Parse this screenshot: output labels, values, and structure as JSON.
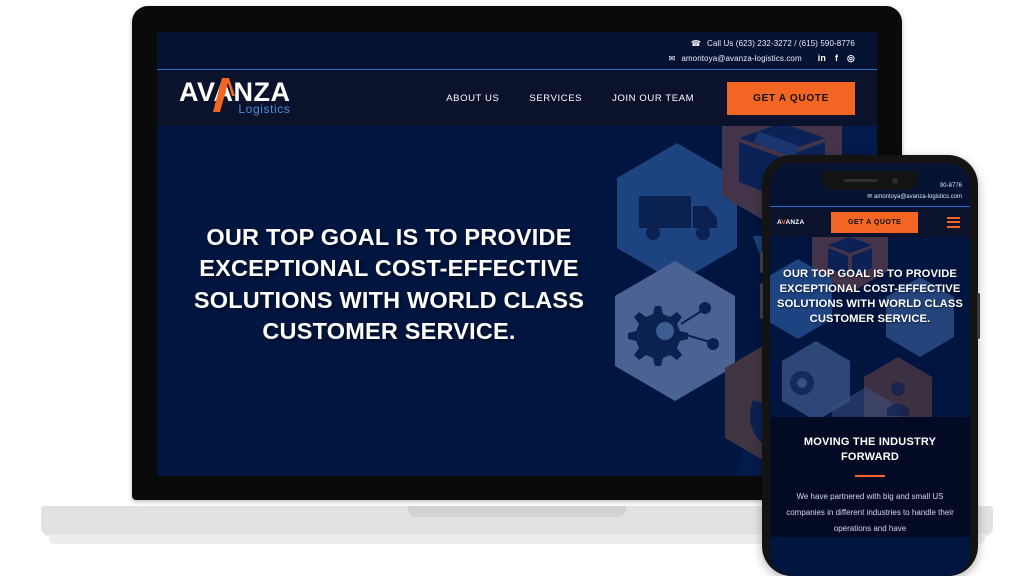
{
  "device_mockup": {
    "devices": [
      "laptop",
      "phone"
    ],
    "background_color": "#ffffff"
  },
  "colors": {
    "navy": "#001540",
    "header_navy": "#0b122c",
    "topbar_navy": "#051232",
    "accent_orange": "#f26522",
    "logo_blue": "#4a8fe0",
    "rule_blue": "#2a6bd4",
    "section_dark": "#030b24"
  },
  "site": {
    "topbar": {
      "phone_icon": "phone-icon",
      "phone_text": "Call Us (623) 232-3272 / (615) 590-8776",
      "mail_icon": "envelope-icon",
      "email": "amontoya@avanza-logistics.com",
      "socials": [
        {
          "name": "linkedin-icon",
          "glyph": "in"
        },
        {
          "name": "facebook-icon",
          "glyph": "f"
        },
        {
          "name": "instagram-icon",
          "glyph": "◎"
        }
      ]
    },
    "brand": {
      "name": "AVANZA",
      "tagline": "Logistics"
    },
    "nav": {
      "links": [
        {
          "label": "ABOUT US"
        },
        {
          "label": "SERVICES"
        },
        {
          "label": "JOIN OUR TEAM"
        }
      ],
      "cta_label": "GET A QUOTE"
    },
    "hero": {
      "headline": "OUR TOP GOAL IS TO PROVIDE EXCEPTIONAL COST-EFFECTIVE SOLUTIONS WITH WORLD CLASS CUSTOMER SERVICE.",
      "art": {
        "watermark": "VA",
        "hexagon_icons": [
          "box-icon",
          "truck-icon",
          "gear-network-icon",
          "hands-person-icon"
        ]
      }
    }
  },
  "phone_site": {
    "topbar": {
      "phone_text_clipped": "90-8776",
      "email": "amontoya@avanza-logistics.com"
    },
    "navbar": {
      "logo_a": "A",
      "logo_v": "V",
      "logo_rest": "ANZA",
      "cta_label": "GET A QUOTE",
      "menu_icon": "hamburger-menu-icon"
    },
    "hero": {
      "headline": "OUR TOP GOAL IS TO PROVIDE EXCEPTIONAL COST-EFFECTIVE SOLUTIONS WITH WORLD CLASS CUSTOMER SERVICE."
    },
    "section": {
      "title": "MOVING THE INDUSTRY FORWARD",
      "body": "We have partnered with big and small US companies in different industries to handle their operations and have"
    }
  }
}
